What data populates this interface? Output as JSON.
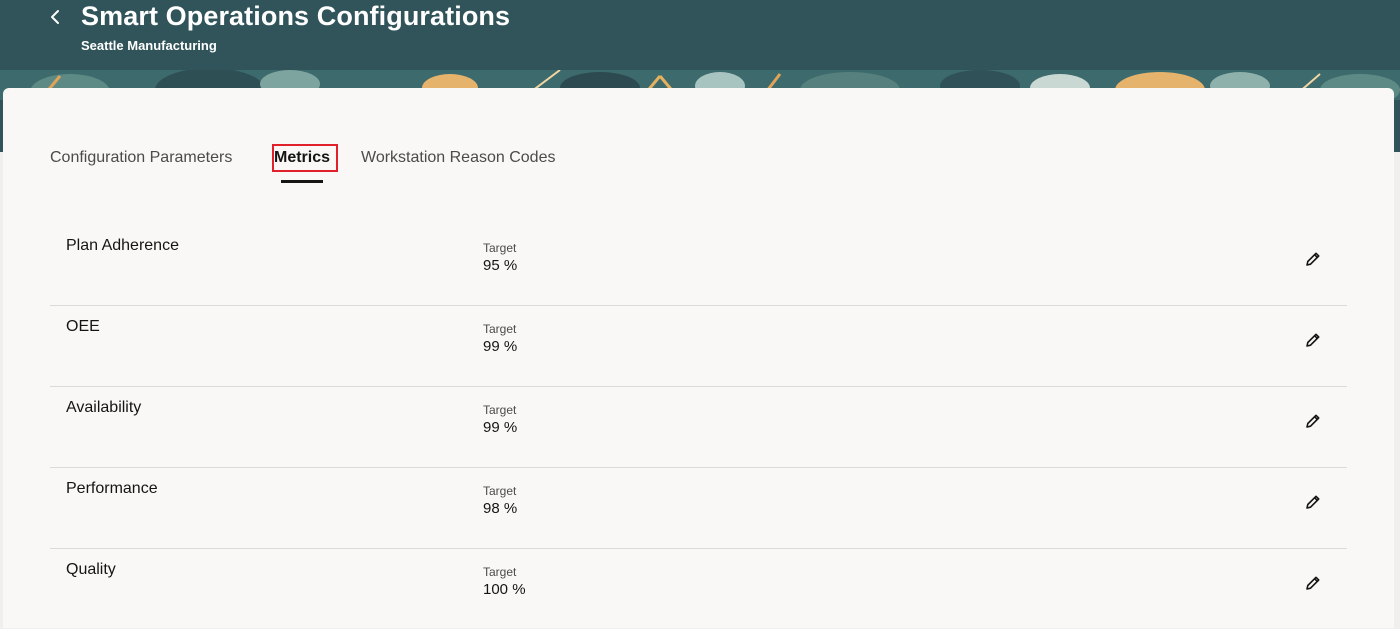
{
  "header": {
    "title": "Smart Operations Configurations",
    "subtitle": "Seattle Manufacturing",
    "back_icon": "chevron-left-icon"
  },
  "tabs": [
    {
      "label": "Configuration Parameters",
      "active": false
    },
    {
      "label": "Metrics",
      "active": true
    },
    {
      "label": "Workstation Reason Codes",
      "active": false
    }
  ],
  "metrics": [
    {
      "name": "Plan Adherence",
      "target_label": "Target",
      "target_value": "95 %"
    },
    {
      "name": "OEE",
      "target_label": "Target",
      "target_value": "99 %"
    },
    {
      "name": "Availability",
      "target_label": "Target",
      "target_value": "99 %"
    },
    {
      "name": "Performance",
      "target_label": "Target",
      "target_value": "98 %"
    },
    {
      "name": "Quality",
      "target_label": "Target",
      "target_value": "100 %"
    }
  ],
  "edit_icon": "pencil-icon",
  "colors": {
    "header_bg": "#30545a",
    "highlight_border": "#e0202a",
    "page_bg": "#f9f8f6"
  }
}
